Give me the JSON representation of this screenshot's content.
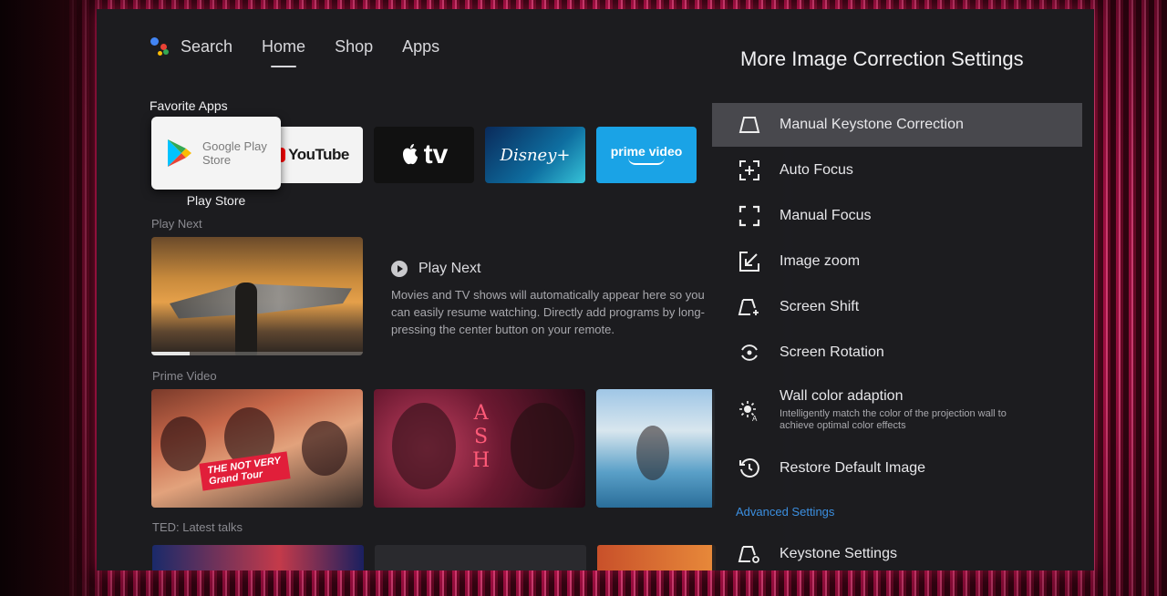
{
  "nav": {
    "search_label": "Search",
    "tabs": [
      {
        "label": "Home",
        "active": true
      },
      {
        "label": "Shop",
        "active": false
      },
      {
        "label": "Apps",
        "active": false
      }
    ]
  },
  "favorite_apps": {
    "heading": "Favorite Apps",
    "focused": {
      "name_line1": "Google Play",
      "name_line2": "Store",
      "caption": "Play Store"
    },
    "apps": [
      "YouTube",
      "tv",
      "Disney+",
      "prime video"
    ]
  },
  "play_next": {
    "heading": "Play Next",
    "info_title": "Play Next",
    "info_description": "Movies and TV shows will automatically appear here so you can easily resume watching. Directly add programs by long-pressing the center button on your remote.",
    "progress": 0.18
  },
  "prime_video": {
    "heading": "Prime Video",
    "cards": [
      {
        "badge_line1": "THE NOT VERY",
        "badge_line2": "Grand Tour"
      },
      {
        "title_letters": [
          "A",
          "S",
          "H"
        ]
      },
      {}
    ]
  },
  "ted": {
    "heading": "TED: Latest talks"
  },
  "settings_panel": {
    "title": "More Image Correction Settings",
    "items": [
      {
        "label": "Manual Keystone Correction",
        "icon": "trapezoid-icon",
        "selected": true
      },
      {
        "label": "Auto Focus",
        "icon": "auto-focus-icon"
      },
      {
        "label": "Manual Focus",
        "icon": "focus-frame-icon"
      },
      {
        "label": "Image zoom",
        "icon": "zoom-arrow-icon"
      },
      {
        "label": "Screen Shift",
        "icon": "screen-shift-icon"
      },
      {
        "label": "Screen Rotation",
        "icon": "rotation-icon"
      },
      {
        "label": "Wall color adaption",
        "icon": "brightness-auto-icon",
        "subtitle": "Intelligently match the color of the projection wall to achieve optimal color effects"
      },
      {
        "label": "Restore Default Image",
        "icon": "restore-icon"
      }
    ],
    "advanced_link": "Advanced Settings",
    "keystone_settings": "Keystone Settings"
  },
  "colors": {
    "accent_link": "#3b8fe0",
    "led_pink": "#ff4f8e"
  }
}
